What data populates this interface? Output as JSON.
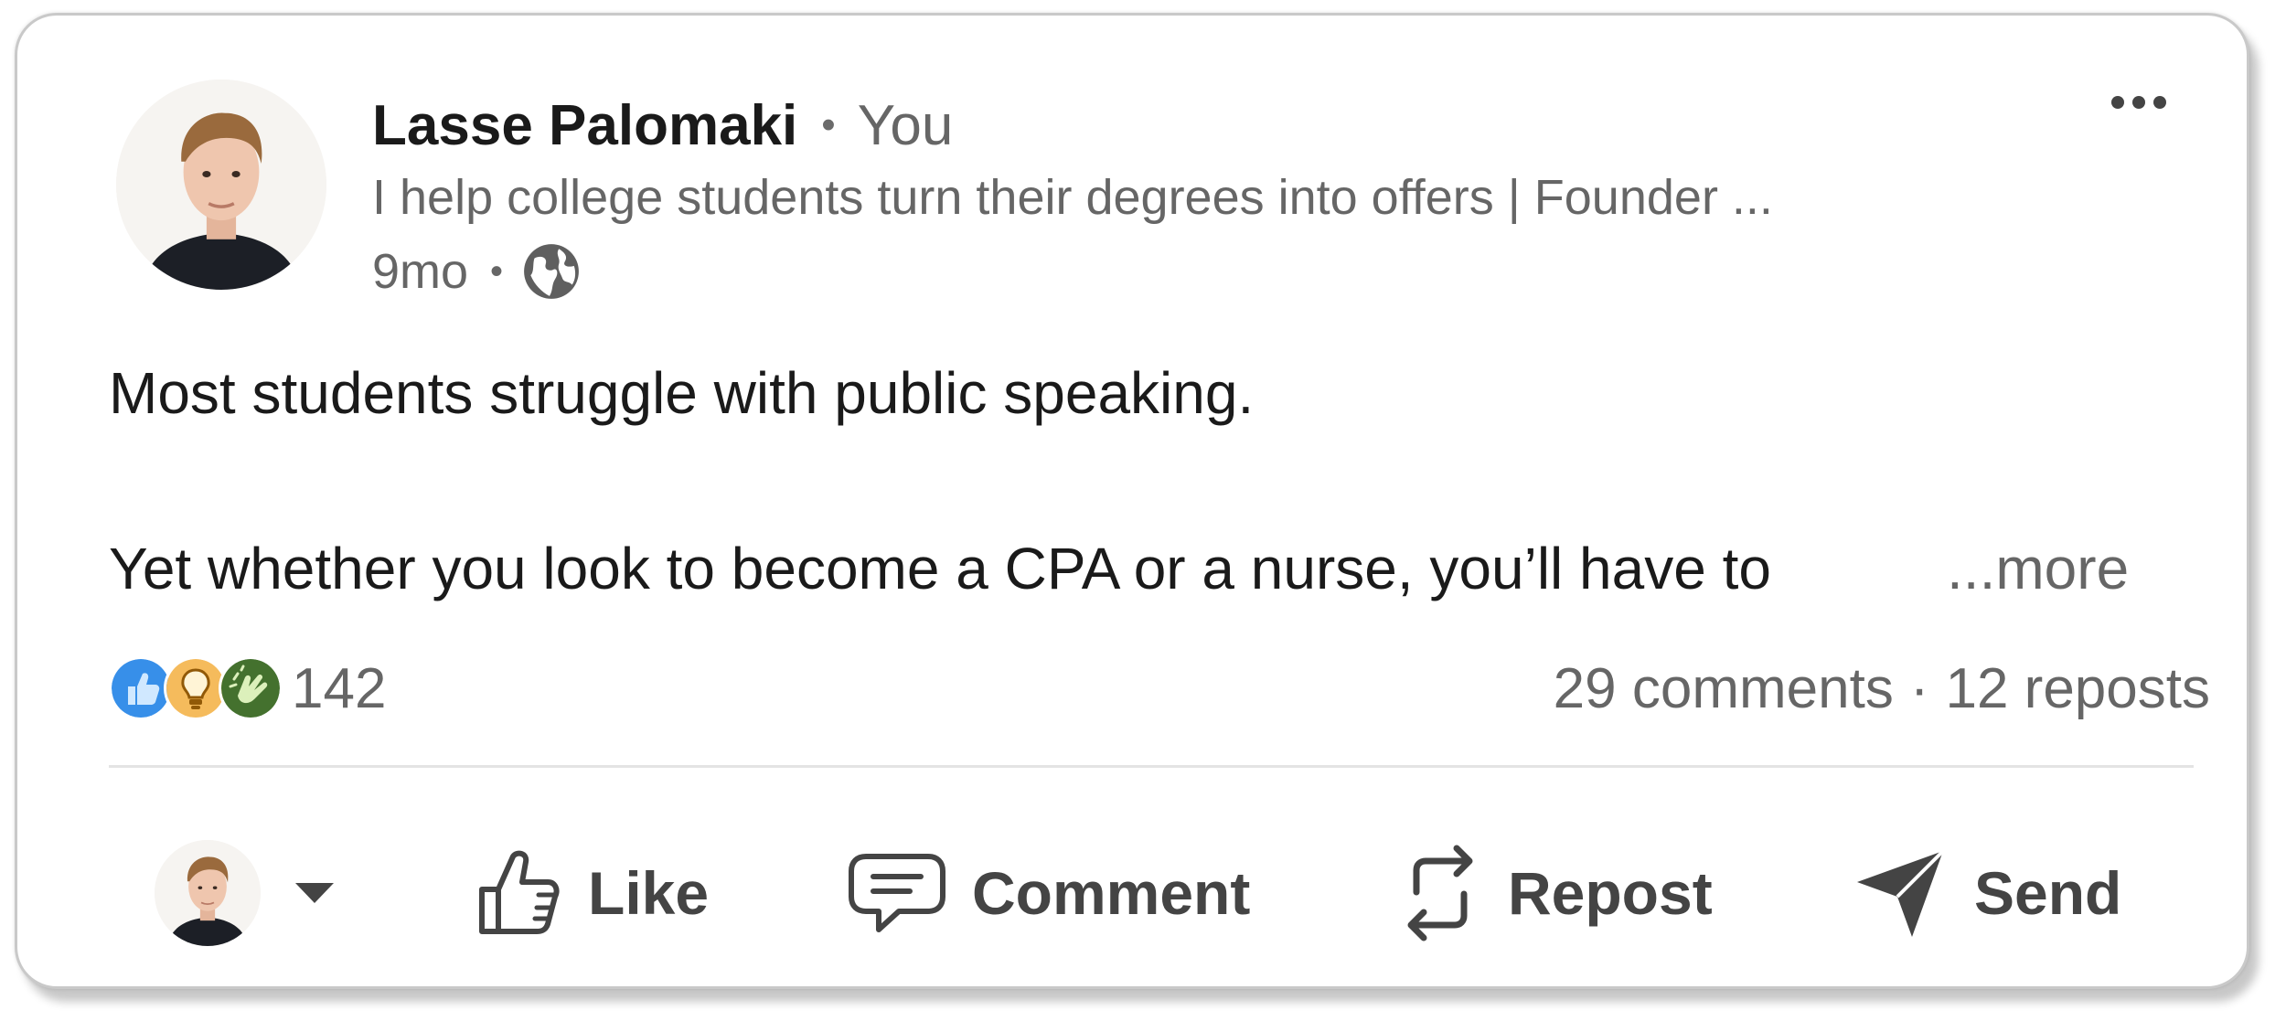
{
  "post": {
    "author": {
      "name": "Lasse Palomaki",
      "separator": "•",
      "degree": "You",
      "headline": "I help college students turn their degrees into offers | Founder ...",
      "time": "9mo",
      "time_separator": "•",
      "visibility_icon": "globe-icon"
    },
    "menu_icon": "more-options-icon",
    "body": {
      "line1": "Most students struggle with public speaking.",
      "line2": "Yet whether you look to become a CPA or a nurse, you’ll have to",
      "see_more": "...more"
    },
    "reactions": {
      "icons": [
        "like-reaction-icon",
        "insightful-reaction-icon",
        "celebrate-reaction-icon"
      ],
      "count": "142"
    },
    "social_counts": {
      "comments": "29 comments",
      "separator": "·",
      "reposts": "12 reposts"
    },
    "actions": {
      "like": "Like",
      "comment": "Comment",
      "repost": "Repost",
      "send": "Send"
    }
  },
  "colors": {
    "text_primary": "#1a1a1a",
    "text_secondary": "#666666",
    "action_text": "#444444",
    "like_blue": "#378fe9",
    "insightful_yellow": "#f5bb5c",
    "celebrate_green": "#44712e",
    "card_border": "#c9c9c9"
  }
}
